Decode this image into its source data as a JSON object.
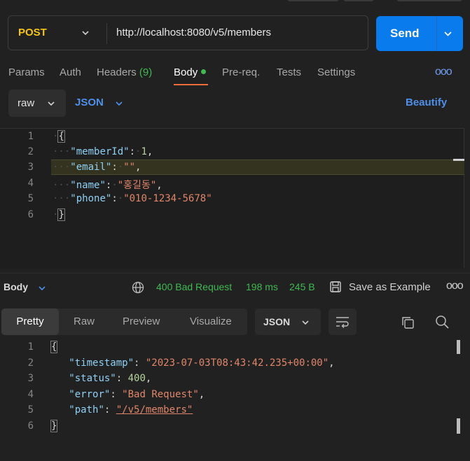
{
  "request": {
    "method": "POST",
    "url": "http://localhost:8080/v5/members",
    "send_label": "Send"
  },
  "tabs": [
    {
      "label": "Params"
    },
    {
      "label": "Auth"
    },
    {
      "label": "Headers",
      "count": "(9)"
    },
    {
      "label": "Body"
    },
    {
      "label": "Pre-req."
    },
    {
      "label": "Tests"
    },
    {
      "label": "Settings"
    }
  ],
  "more_label": "ooo",
  "body_options": {
    "mode": "raw",
    "language": "JSON",
    "beautify_label": "Beautify"
  },
  "request_body": {
    "line_numbers": [
      "1",
      "2",
      "3",
      "4",
      "5",
      "6"
    ],
    "open_brace": "{",
    "close_brace": "}",
    "fields": [
      {
        "key": "\"memberId\"",
        "value": "1",
        "type": "number",
        "comma": ","
      },
      {
        "key": "\"email\"",
        "value": "\"\"",
        "type": "string",
        "comma": ","
      },
      {
        "key": "\"name\"",
        "value": "\"홍길동\"",
        "type": "string",
        "comma": ","
      },
      {
        "key": "\"phone\"",
        "value": "\"010-1234-5678\"",
        "type": "string",
        "comma": ""
      }
    ]
  },
  "response": {
    "body_label": "Body",
    "status": "400 Bad Request",
    "time": "198 ms",
    "size": "245 B",
    "save_label": "Save as Example",
    "more_label": "ooo",
    "view_tabs": [
      "Pretty",
      "Raw",
      "Preview",
      "Visualize"
    ],
    "format": "JSON",
    "line_numbers": [
      "1",
      "2",
      "3",
      "4",
      "5",
      "6"
    ],
    "open_brace": "{",
    "close_brace": "}",
    "fields": [
      {
        "key": "\"timestamp\"",
        "value": "\"2023-07-03T08:43:42.235+00:00\"",
        "type": "string",
        "comma": ","
      },
      {
        "key": "\"status\"",
        "value": "400",
        "type": "number",
        "comma": ","
      },
      {
        "key": "\"error\"",
        "value": "\"Bad Request\"",
        "type": "string",
        "comma": ","
      },
      {
        "key": "\"path\"",
        "value": "\"/v5/members\"",
        "type": "link",
        "comma": ""
      }
    ]
  },
  "colors": {
    "accent": "#097bed",
    "method": "#f5c518",
    "success": "#3fb950",
    "active_tab_underline": "#f26b3a"
  }
}
